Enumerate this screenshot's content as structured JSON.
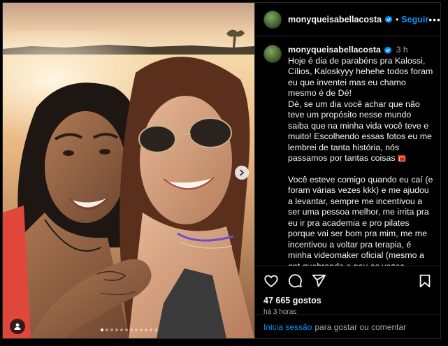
{
  "post": {
    "username": "monyqueisabellacosta",
    "follow_label": "Seguir",
    "more_label": "•••",
    "caption_time": "3 h",
    "caption_paragraphs": [
      "Hoje é dia de parabéns pra Kalossi, Cílios, Kaloskyyy hehehe todos foram eu que inventei mas eu chamo mesmo é de Dé!",
      "Dé, se um dia você achar que não teve um propósito nesse mundo saiba que na minha vida você teve e muito! Escolhendo essas fotos eu me lembrei de tanta história, nós passamos por tantas coisas",
      "Você esteve comigo quando eu caí (e foram várias vezes kkk) e me ajudou a levantar, sempre me incentivou a ser uma pessoa melhor, me irrita pra eu ir pra academia e pro pilates porque vai ser bom pra mim, me me incentivou a voltar pra terapia, é minha videomaker oficial (mesmo a gnt quebrando o pau as vezes hehhe) São tantas coisas que não cabem num texto!"
    ],
    "likes": "47 665 gostos",
    "posted_ago": "há 3 horas",
    "login_link": "Inicia sessão",
    "login_text": "para gostar ou comentar"
  },
  "carousel": {
    "count": 12,
    "active_index": 0
  },
  "colors": {
    "accent": "#0095f6",
    "background": "#000000",
    "border": "#262626",
    "muted_text": "#a8a8a8"
  },
  "icons": [
    "verified-badge-icon",
    "more-options-icon",
    "heart-icon",
    "comment-icon",
    "share-icon",
    "bookmark-icon",
    "chevron-right-icon",
    "user-tag-icon"
  ]
}
